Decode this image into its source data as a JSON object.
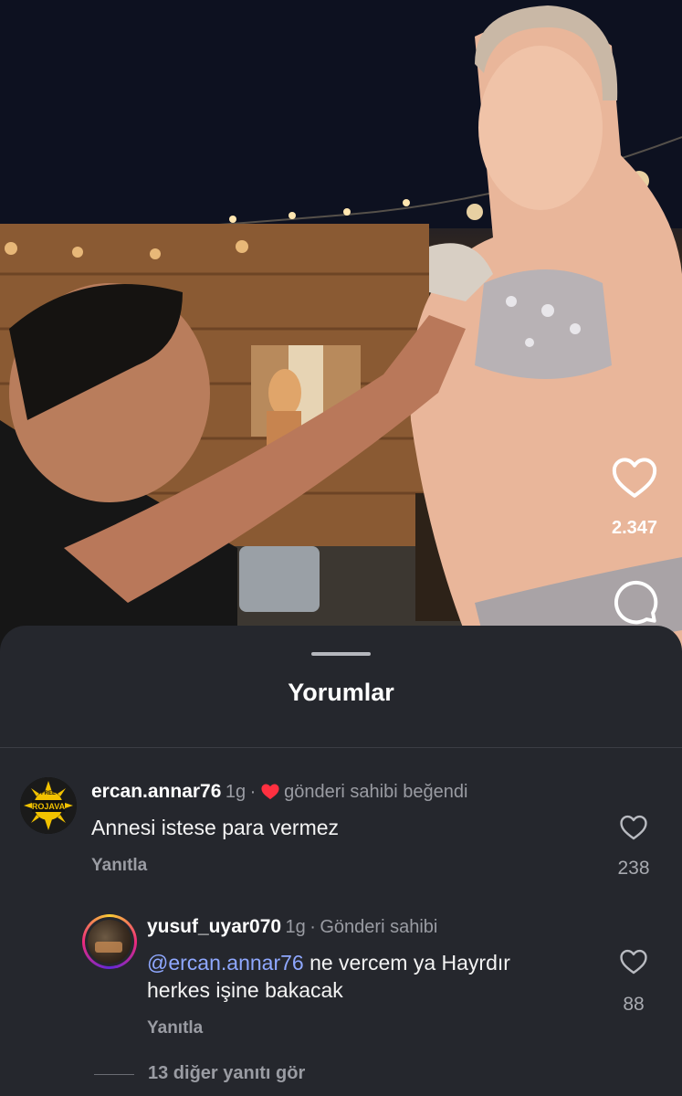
{
  "post": {
    "like_count": "2.347",
    "icons": {
      "like": "heart-outline-icon",
      "comment": "speech-bubble-icon"
    }
  },
  "comments_sheet": {
    "title": "Yorumlar",
    "comments": [
      {
        "username": "ercan.annar76",
        "time": "1g",
        "separator": "·",
        "liked_by_author": "gönderi sahibi beğendi",
        "text": "Annesi istese para vermez",
        "reply_label": "Yanıtla",
        "like_count": "238",
        "avatar_text": [
          "FREE",
          "ROJAVA"
        ]
      }
    ],
    "reply": {
      "username": "yusuf_uyar070",
      "time": "1g",
      "separator": "·",
      "badge": "Gönderi sahibi",
      "mention": "@ercan.annar76",
      "text_after_mention": " ne vercem ya Hayrdır",
      "text_line2": "herkes işine bakacak",
      "reply_label": "Yanıtla",
      "like_count": "88"
    },
    "more_replies": "13 diğer yanıtı gör"
  },
  "colors": {
    "sheet_bg": "#25272d",
    "heart_red": "#ff3040",
    "mention_blue": "#8fa8ff",
    "muted_text": "#9a9ca3"
  }
}
